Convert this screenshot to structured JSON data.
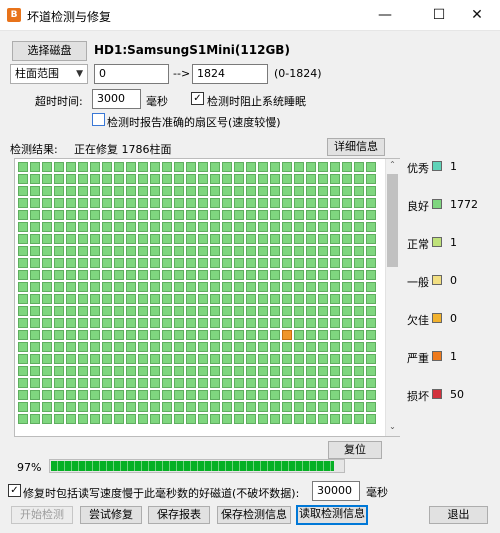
{
  "window": {
    "title": "坏道检测与修复",
    "icon_text": "B",
    "minimize": "—",
    "maximize": "☐",
    "close": "✕"
  },
  "disk": {
    "select_button": "选择磁盘",
    "name": "HD1:SamsungS1Mini(112GB)"
  },
  "range": {
    "mode": "柱面范围",
    "start": "0",
    "separator": "-->",
    "end": "1824",
    "hint": "(0-1824)"
  },
  "timeout": {
    "label": "超时时间:",
    "value": "3000",
    "unit": "毫秒"
  },
  "options": {
    "prevent_sleep": {
      "label": "检测时阻止系统睡眠",
      "checked": true
    },
    "report_sector": {
      "label": "检测时报告准确的扇区号(速度较慢)",
      "checked": false
    },
    "repair_slow": {
      "label": "修复时包括读写速度慢于此毫秒数的好磁道(不破坏数据):",
      "checked": true,
      "value": "30000",
      "unit": "毫秒"
    }
  },
  "result": {
    "label": "检测结果:",
    "status": "正在修复 1786柱面",
    "detail_button": "详细信息",
    "reset_button": "复位"
  },
  "legend": [
    {
      "label": "优秀",
      "count": "1",
      "color": "#5fd3b8"
    },
    {
      "label": "良好",
      "count": "1772",
      "color": "#7fd67f"
    },
    {
      "label": "正常",
      "count": "1",
      "color": "#bfe27a"
    },
    {
      "label": "一般",
      "count": "0",
      "color": "#f2df82"
    },
    {
      "label": "欠佳",
      "count": "0",
      "color": "#f2b22e"
    },
    {
      "label": "严重",
      "count": "1",
      "color": "#ee7a1c"
    },
    {
      "label": "损坏",
      "count": "50",
      "color": "#d2323c"
    }
  ],
  "progress": {
    "percent_text": "97%",
    "value": 0.97
  },
  "buttons": {
    "start": "开始检测",
    "try_repair": "尝试修复",
    "save_report": "保存报表",
    "save_info": "保存检测信息",
    "read_info": "读取检测信息",
    "exit": "退出"
  },
  "scroll": {
    "up": "⌃",
    "down": "⌄"
  },
  "checkmark": "✓"
}
